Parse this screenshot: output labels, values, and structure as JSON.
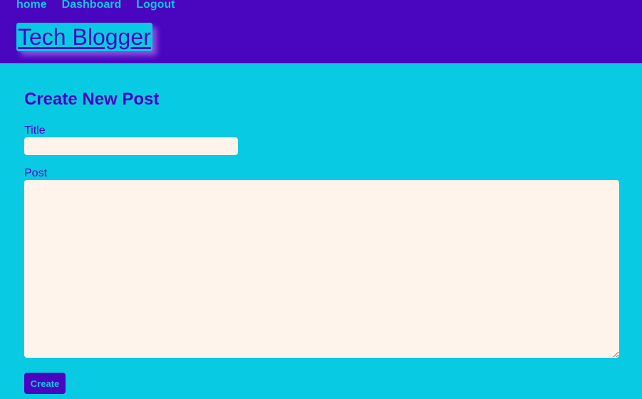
{
  "nav": {
    "items": [
      {
        "label": "home"
      },
      {
        "label": "Dashboard"
      },
      {
        "label": "Logout"
      }
    ]
  },
  "brand": {
    "title": "Tech Blogger"
  },
  "main": {
    "heading": "Create New Post",
    "form": {
      "title_label": "Title",
      "title_value": "",
      "post_label": "Post",
      "post_value": "",
      "submit_label": "Create"
    }
  },
  "colors": {
    "header_bg": "#4a05bf",
    "page_bg": "#08cbe3",
    "field_bg": "#fff4eb",
    "accent_text": "#0dc7e6"
  }
}
